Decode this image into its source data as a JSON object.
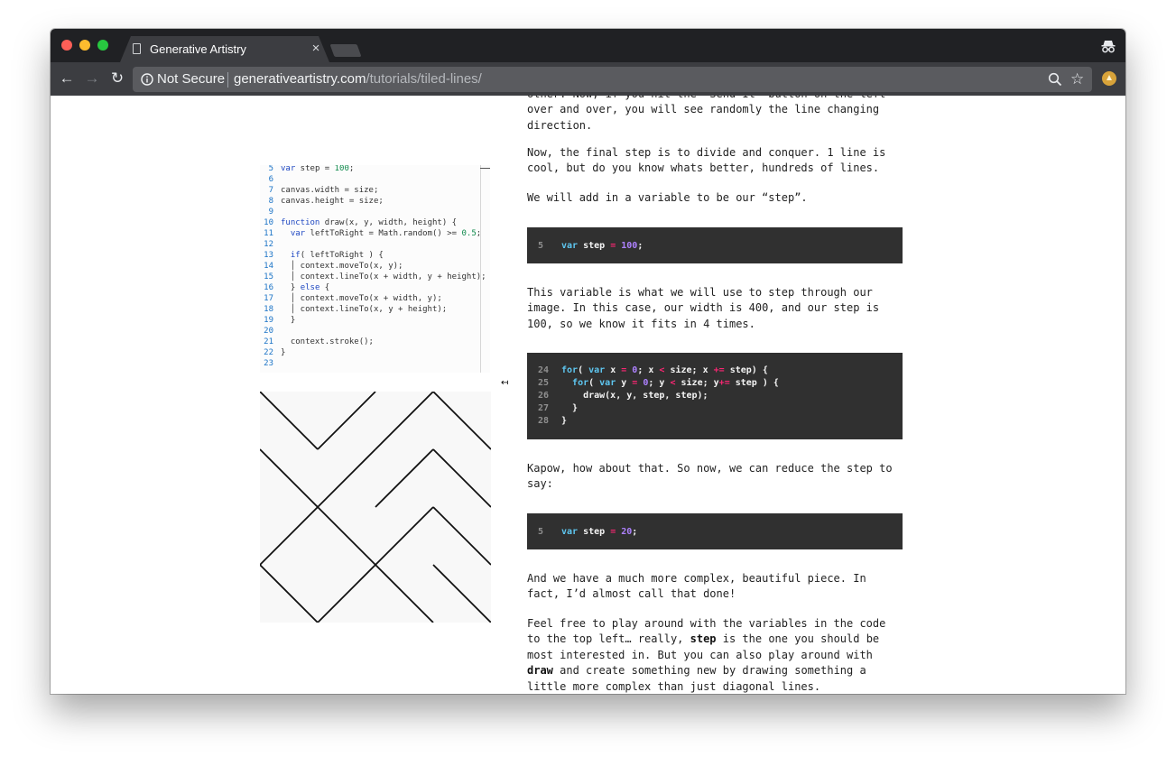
{
  "browser": {
    "tab_title": "Generative Artistry",
    "tab_close": "×",
    "security_label": "Not Secure",
    "url_domain": "generativeartistry.com",
    "url_path": "/tutorials/tiled-lines/",
    "back_glyph": "←",
    "forward_glyph": "→",
    "reload_glyph": "↻",
    "star_glyph": "☆",
    "icons": [
      "file-icon",
      "close-icon",
      "incognito-icon",
      "back-arrow-icon",
      "forward-arrow-icon",
      "reload-icon",
      "info-icon",
      "zoom-icon",
      "star-icon",
      "extension-icon"
    ]
  },
  "editor": {
    "collapse_glyph": "↤",
    "lines": [
      {
        "n": "5",
        "parts": [
          {
            "t": "kw",
            "v": "var"
          },
          {
            "t": "",
            "v": " step = "
          },
          {
            "t": "num",
            "v": "100"
          },
          {
            "t": "",
            "v": ";"
          }
        ]
      },
      {
        "n": "6",
        "parts": []
      },
      {
        "n": "7",
        "parts": [
          {
            "t": "",
            "v": "canvas.width = size;"
          }
        ]
      },
      {
        "n": "8",
        "parts": [
          {
            "t": "",
            "v": "canvas.height = size;"
          }
        ]
      },
      {
        "n": "9",
        "parts": []
      },
      {
        "n": "10",
        "parts": [
          {
            "t": "kw",
            "v": "function"
          },
          {
            "t": "",
            "v": " draw(x, y, width, height) {"
          }
        ]
      },
      {
        "n": "11",
        "parts": [
          {
            "t": "",
            "v": "  "
          },
          {
            "t": "kw",
            "v": "var"
          },
          {
            "t": "",
            "v": " leftToRight = Math.random() >= "
          },
          {
            "t": "num",
            "v": "0.5"
          },
          {
            "t": "",
            "v": ";"
          }
        ]
      },
      {
        "n": "12",
        "parts": []
      },
      {
        "n": "13",
        "parts": [
          {
            "t": "",
            "v": "  "
          },
          {
            "t": "kw",
            "v": "if"
          },
          {
            "t": "",
            "v": "( leftToRight ) {"
          }
        ]
      },
      {
        "n": "14",
        "parts": [
          {
            "t": "",
            "v": "  │ context.moveTo(x, y);"
          }
        ]
      },
      {
        "n": "15",
        "parts": [
          {
            "t": "",
            "v": "  │ context.lineTo(x + width, y + height);"
          }
        ]
      },
      {
        "n": "16",
        "parts": [
          {
            "t": "",
            "v": "  } "
          },
          {
            "t": "kw",
            "v": "else"
          },
          {
            "t": "",
            "v": " {"
          }
        ]
      },
      {
        "n": "17",
        "parts": [
          {
            "t": "",
            "v": "  │ context.moveTo(x + width, y);"
          }
        ]
      },
      {
        "n": "18",
        "parts": [
          {
            "t": "",
            "v": "  │ context.lineTo(x, y + height);"
          }
        ]
      },
      {
        "n": "19",
        "parts": [
          {
            "t": "",
            "v": "  }"
          }
        ]
      },
      {
        "n": "20",
        "parts": []
      },
      {
        "n": "21",
        "parts": [
          {
            "t": "",
            "v": "  context.stroke();"
          }
        ]
      },
      {
        "n": "22",
        "parts": [
          {
            "t": "",
            "v": "}"
          }
        ]
      },
      {
        "n": "23",
        "parts": []
      }
    ]
  },
  "artwork": {
    "tile_directions": [
      "ltr",
      "rtl",
      "rtl",
      "ltr",
      "ltr",
      "rtl",
      "rtl",
      "ltr",
      "rtl",
      "ltr",
      "rtl",
      "ltr",
      "ltr",
      "rtl",
      "ltr",
      "ltr"
    ]
  },
  "article": {
    "para_top": [
      {
        "runs": [
          {
            "t": "",
            "v": "other. Now, if you hit the “Send It” button on the left"
          }
        ]
      },
      {
        "runs": [
          {
            "t": "",
            "v": "over and over, you will see randomly the line changing"
          }
        ]
      },
      {
        "runs": [
          {
            "t": "",
            "v": "direction."
          }
        ]
      }
    ],
    "para_divide": [
      {
        "runs": [
          {
            "t": "",
            "v": "Now, the final step is to divide and conquer. 1 line is"
          }
        ]
      },
      {
        "runs": [
          {
            "t": "",
            "v": "cool, but do you know whats better, hundreds of lines."
          }
        ]
      }
    ],
    "para_step": [
      {
        "runs": [
          {
            "t": "",
            "v": "We will add in a variable to be our “step”."
          }
        ]
      }
    ],
    "para_variable": [
      {
        "runs": [
          {
            "t": "",
            "v": "This variable is what we will use to step through our"
          }
        ]
      },
      {
        "runs": [
          {
            "t": "",
            "v": "image. In this case, our width is 400, and our step is"
          }
        ]
      },
      {
        "runs": [
          {
            "t": "",
            "v": "100, so we know it fits in 4 times."
          }
        ]
      }
    ],
    "para_kapow": [
      {
        "runs": [
          {
            "t": "",
            "v": "Kapow, how about that. So now, we can reduce the step to"
          }
        ]
      },
      {
        "runs": [
          {
            "t": "",
            "v": "say:"
          }
        ]
      }
    ],
    "para_complex": [
      {
        "runs": [
          {
            "t": "",
            "v": "And we have a much more complex, beautiful piece. In"
          }
        ]
      },
      {
        "runs": [
          {
            "t": "",
            "v": "fact, I’d almost call that done!"
          }
        ]
      }
    ],
    "para_feelfree": [
      {
        "runs": [
          {
            "t": "",
            "v": "Feel free to play around with the variables in the code"
          }
        ]
      },
      {
        "runs": [
          {
            "t": "",
            "v": "to the top left… really, "
          },
          {
            "t": "b",
            "v": "step"
          },
          {
            "t": "",
            "v": " is the one you should be"
          }
        ]
      },
      {
        "runs": [
          {
            "t": "",
            "v": "most interested in. But you can also play around with"
          }
        ]
      },
      {
        "runs": [
          {
            "t": "b",
            "v": "draw"
          },
          {
            "t": "",
            "v": " and create something new by drawing something a"
          }
        ]
      },
      {
        "runs": [
          {
            "t": "",
            "v": "little more complex than just diagonal lines."
          }
        ]
      }
    ],
    "code_step100": [
      {
        "n": "5",
        "parts": [
          {
            "t": "c-kw",
            "v": "var"
          },
          {
            "t": "",
            "v": " step "
          },
          {
            "t": "c-op",
            "v": "="
          },
          {
            "t": "",
            "v": " "
          },
          {
            "t": "c-num",
            "v": "100"
          },
          {
            "t": "",
            "v": ";"
          }
        ]
      }
    ],
    "code_loop": [
      {
        "n": "24",
        "parts": [
          {
            "t": "c-kw",
            "v": "for"
          },
          {
            "t": "",
            "v": "( "
          },
          {
            "t": "c-kw",
            "v": "var"
          },
          {
            "t": "",
            "v": " x "
          },
          {
            "t": "c-op",
            "v": "="
          },
          {
            "t": "",
            "v": " "
          },
          {
            "t": "c-num",
            "v": "0"
          },
          {
            "t": "",
            "v": "; x "
          },
          {
            "t": "c-op",
            "v": "<"
          },
          {
            "t": "",
            "v": " size; x "
          },
          {
            "t": "c-op",
            "v": "+="
          },
          {
            "t": "",
            "v": " step) {"
          }
        ]
      },
      {
        "n": "25",
        "parts": [
          {
            "t": "",
            "v": "  "
          },
          {
            "t": "c-kw",
            "v": "for"
          },
          {
            "t": "",
            "v": "( "
          },
          {
            "t": "c-kw",
            "v": "var"
          },
          {
            "t": "",
            "v": " y "
          },
          {
            "t": "c-op",
            "v": "="
          },
          {
            "t": "",
            "v": " "
          },
          {
            "t": "c-num",
            "v": "0"
          },
          {
            "t": "",
            "v": "; y "
          },
          {
            "t": "c-op",
            "v": "<"
          },
          {
            "t": "",
            "v": " size; y"
          },
          {
            "t": "c-op",
            "v": "+="
          },
          {
            "t": "",
            "v": " step ) {"
          }
        ]
      },
      {
        "n": "26",
        "parts": [
          {
            "t": "",
            "v": "    draw(x, y, step, step);"
          }
        ]
      },
      {
        "n": "27",
        "parts": [
          {
            "t": "",
            "v": "  }"
          }
        ]
      },
      {
        "n": "28",
        "parts": [
          {
            "t": "",
            "v": "}"
          }
        ]
      }
    ],
    "code_step20": [
      {
        "n": "5",
        "parts": [
          {
            "t": "c-kw",
            "v": "var"
          },
          {
            "t": "",
            "v": " step "
          },
          {
            "t": "c-op",
            "v": "="
          },
          {
            "t": "",
            "v": " "
          },
          {
            "t": "c-num",
            "v": "20"
          },
          {
            "t": "",
            "v": ";"
          }
        ]
      }
    ]
  }
}
